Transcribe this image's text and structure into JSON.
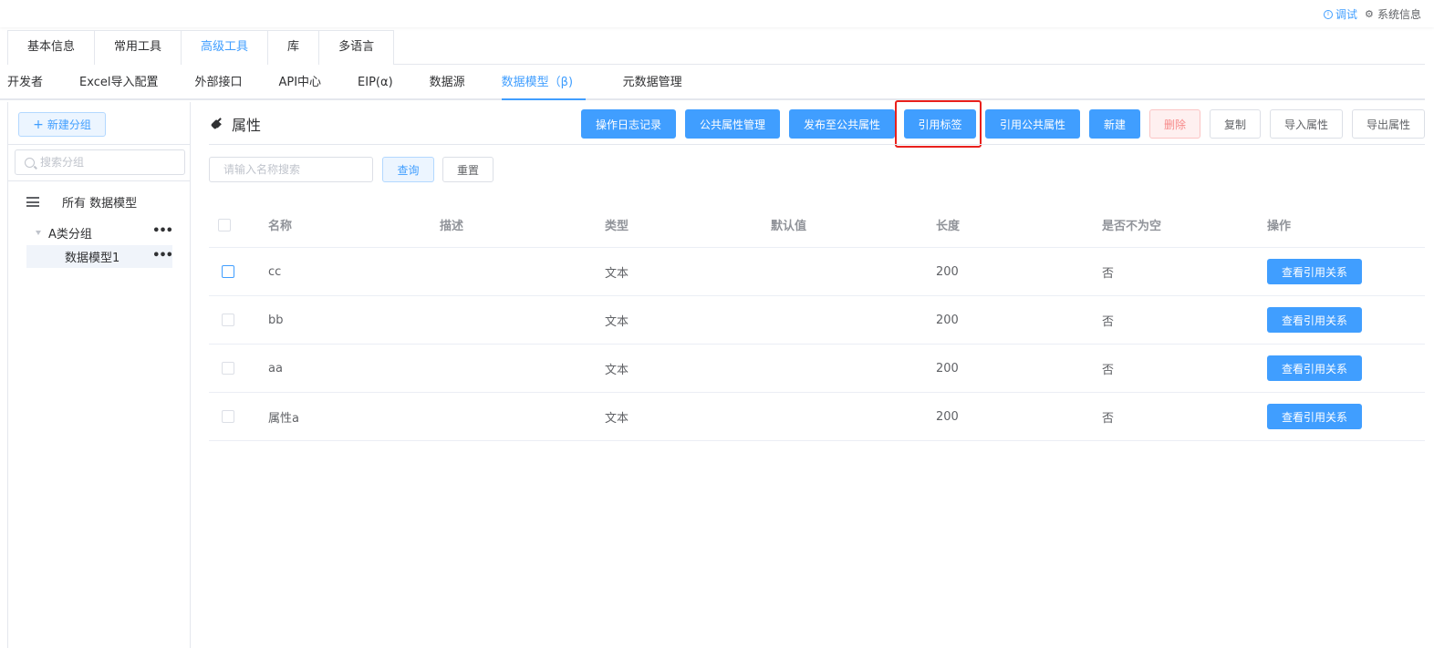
{
  "header": {
    "debug_label": "调试",
    "sysinfo_label": "系统信息"
  },
  "main_tabs": [
    {
      "label": "基本信息",
      "active": false
    },
    {
      "label": "常用工具",
      "active": false
    },
    {
      "label": "高级工具",
      "active": true
    },
    {
      "label": "库",
      "active": false
    },
    {
      "label": "多语言",
      "active": false
    }
  ],
  "sub_tabs": [
    {
      "label": "开发者",
      "active": false
    },
    {
      "label": "Excel导入配置",
      "active": false
    },
    {
      "label": "外部接口",
      "active": false
    },
    {
      "label": "API中心",
      "active": false
    },
    {
      "label": "EIP(α)",
      "active": false
    },
    {
      "label": "数据源",
      "active": false
    },
    {
      "label": "数据模型（β)",
      "active": true
    },
    {
      "label": "元数据管理",
      "active": false
    }
  ],
  "sidebar": {
    "new_group_label": "新建分组",
    "search_placeholder": "搜索分组",
    "all_label": "所有 数据模型",
    "groups": [
      {
        "label": "A类分组",
        "children": [
          {
            "label": "数据模型1"
          }
        ]
      }
    ]
  },
  "content": {
    "title": "属性",
    "toolbar": [
      {
        "label": "操作日志记录",
        "style": "primary"
      },
      {
        "label": "公共属性管理",
        "style": "primary"
      },
      {
        "label": "发布至公共属性",
        "style": "primary"
      },
      {
        "label": "引用标签",
        "style": "primary"
      },
      {
        "label": "引用公共属性",
        "style": "primary"
      },
      {
        "label": "新建",
        "style": "primary"
      },
      {
        "label": "删除",
        "style": "danger-plain"
      },
      {
        "label": "复制",
        "style": "default"
      },
      {
        "label": "导入属性",
        "style": "default"
      },
      {
        "label": "导出属性",
        "style": "default"
      }
    ],
    "filter": {
      "placeholder": "请输入名称搜索",
      "query_label": "查询",
      "reset_label": "重置"
    },
    "table": {
      "columns": [
        "名称",
        "描述",
        "类型",
        "默认值",
        "长度",
        "是否不为空",
        "操作"
      ],
      "rows": [
        {
          "name": "cc",
          "desc": "",
          "type": "文本",
          "default": "",
          "length": "200",
          "not_null": "否",
          "action": "查看引用关系"
        },
        {
          "name": "bb",
          "desc": "",
          "type": "文本",
          "default": "",
          "length": "200",
          "not_null": "否",
          "action": "查看引用关系"
        },
        {
          "name": "aa",
          "desc": "",
          "type": "文本",
          "default": "",
          "length": "200",
          "not_null": "否",
          "action": "查看引用关系"
        },
        {
          "name": "属性a",
          "desc": "",
          "type": "文本",
          "default": "",
          "length": "200",
          "not_null": "否",
          "action": "查看引用关系"
        }
      ]
    }
  },
  "colors": {
    "primary": "#409eff",
    "highlight": "#e9201c"
  }
}
